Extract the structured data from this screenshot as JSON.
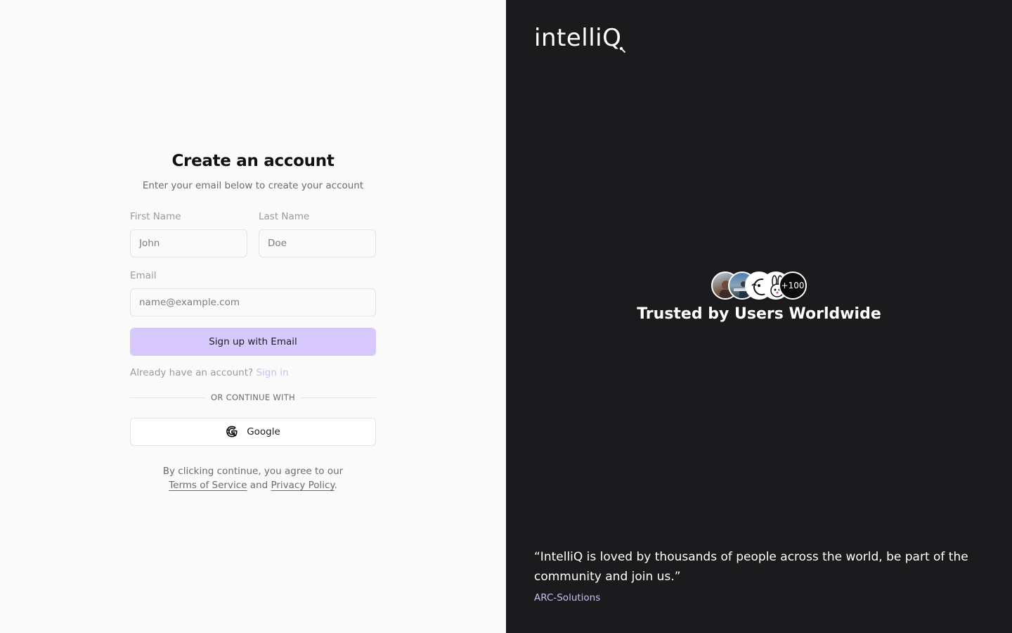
{
  "signup": {
    "title": "Create an account",
    "subtitle": "Enter your email below to create your account",
    "first_name_label": "First Name",
    "first_name_placeholder": "John",
    "last_name_label": "Last Name",
    "last_name_placeholder": "Doe",
    "email_label": "Email",
    "email_placeholder": "name@example.com",
    "submit_label": "Sign up with Email",
    "have_account_text": "Already have an account?",
    "signin_link": "Sign in",
    "divider_text": "OR CONTINUE WITH",
    "google_label": "Google",
    "legal_prefix": "By clicking continue, you agree to our",
    "terms_link": "Terms of Service",
    "legal_and": "and",
    "privacy_link": "Privacy Policy",
    "legal_suffix": "."
  },
  "brand": {
    "logo_text": "intelliQ",
    "avatar_more": "+100",
    "trusted_text": "Trusted by Users Worldwide",
    "quote": "“IntelliQ is loved by thousands of people across the world, be part of the community and join us.”",
    "author": "ARC-Solutions"
  },
  "colors": {
    "accent": "#d7c9fb",
    "accent_text": "#cbbdf3",
    "dark_panel": "#1b1b1d",
    "light_panel": "#fafafa"
  }
}
